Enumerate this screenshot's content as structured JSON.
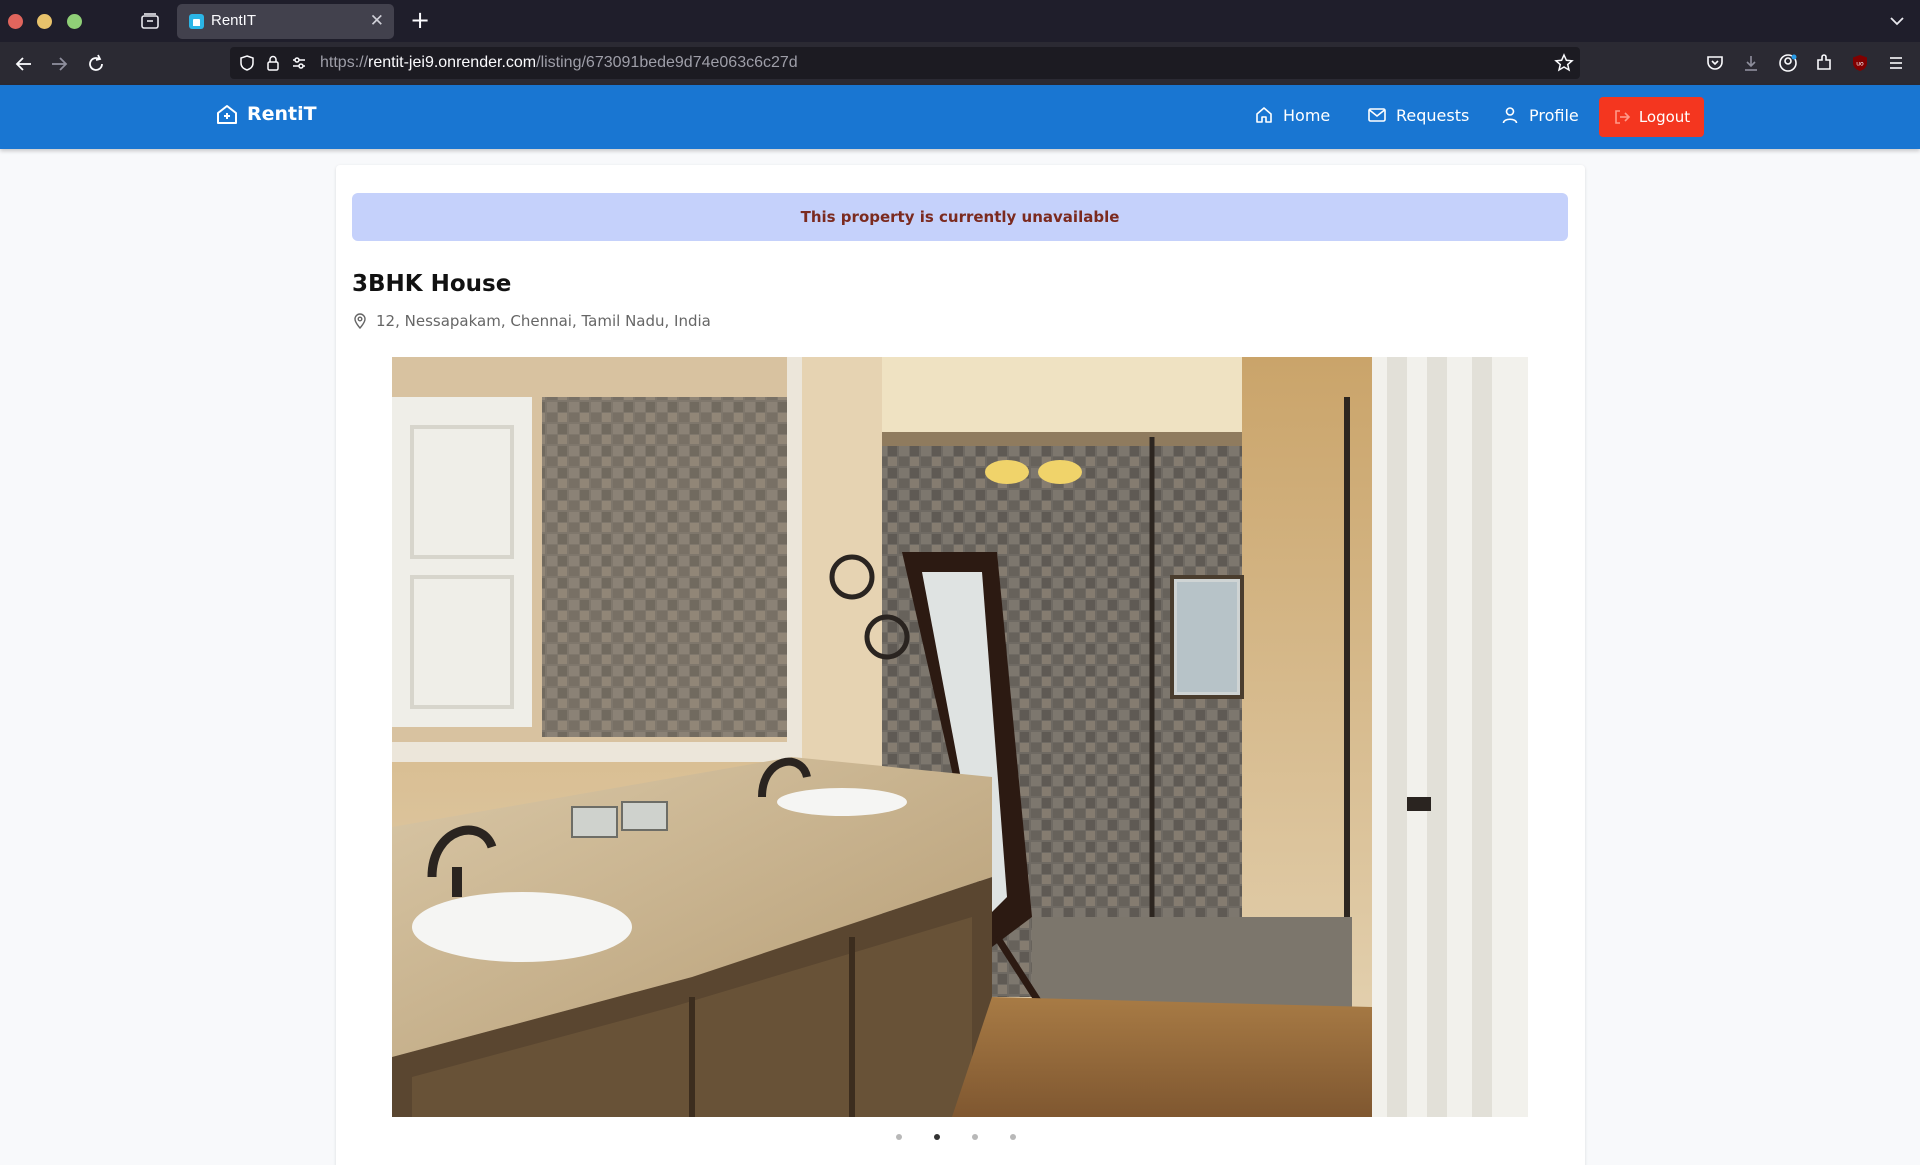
{
  "browser": {
    "tab_title": "RentIT",
    "url_prefix": "https://",
    "url_host": "rentit-jei9.onrender.com",
    "url_path": "/listing/673091bede9d74e063c6c27d"
  },
  "site": {
    "brand": "RentiT",
    "nav": {
      "home": "Home",
      "requests": "Requests",
      "profile": "Profile",
      "logout": "Logout"
    },
    "colors": {
      "nav_bg": "#1976d2",
      "logout_bg": "#f4361f",
      "alert_bg": "#c5d1fb",
      "alert_text": "#7b2a1f"
    }
  },
  "listing": {
    "alert": "This property is currently unavailable",
    "title": "3BHK House",
    "address": "12, Nessapakam, Chennai, Tamil Nadu, India",
    "carousel": {
      "slide_count": 4,
      "active_index": 1
    }
  }
}
